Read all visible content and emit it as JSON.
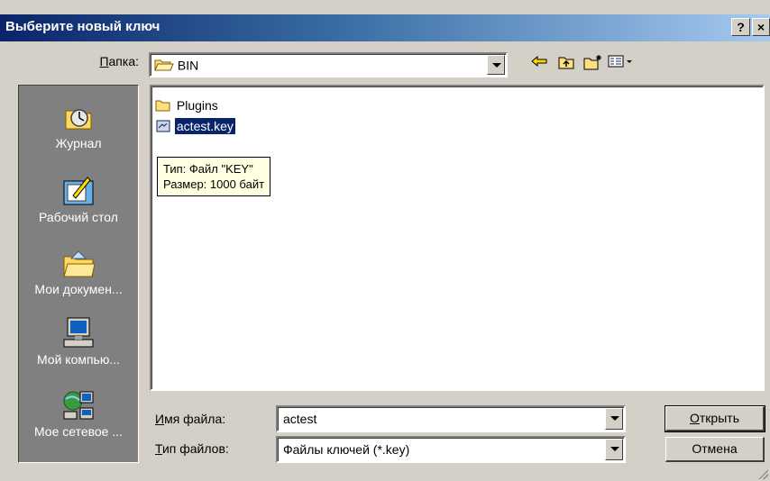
{
  "window": {
    "title": "Выберите новый ключ",
    "help_label": "?",
    "close_label": "×"
  },
  "folder": {
    "label_underlined": "П",
    "label_rest": "апка:",
    "current": "BIN",
    "toolbar_icons": [
      "back-icon",
      "up-folder-icon",
      "new-folder-icon",
      "view-menu-icon"
    ]
  },
  "places": [
    {
      "label": "Журнал",
      "icon": "history-icon"
    },
    {
      "label": "Рабочий стол",
      "icon": "desktop-icon"
    },
    {
      "label": "Мои докумен...",
      "icon": "my-documents-icon"
    },
    {
      "label": "Мой компью...",
      "icon": "my-computer-icon"
    },
    {
      "label": "Мое сетевое ...",
      "icon": "network-places-icon"
    }
  ],
  "files": [
    {
      "name": "Plugins",
      "type": "folder",
      "selected": false
    },
    {
      "name": "actest.key",
      "type": "file",
      "selected": true
    }
  ],
  "tooltip": {
    "line1": "Тип: Файл \"KEY\"",
    "line2": "Размер: 1000 байт"
  },
  "filename": {
    "label_underlined": "И",
    "label_rest": "мя файла:",
    "value": "actest"
  },
  "filetype": {
    "label_underlined": "Т",
    "label_rest": "ип файлов:",
    "value": "Файлы ключей (*.key)"
  },
  "buttons": {
    "open_underlined": "О",
    "open_rest": "ткрыть",
    "cancel": "Отмена"
  }
}
